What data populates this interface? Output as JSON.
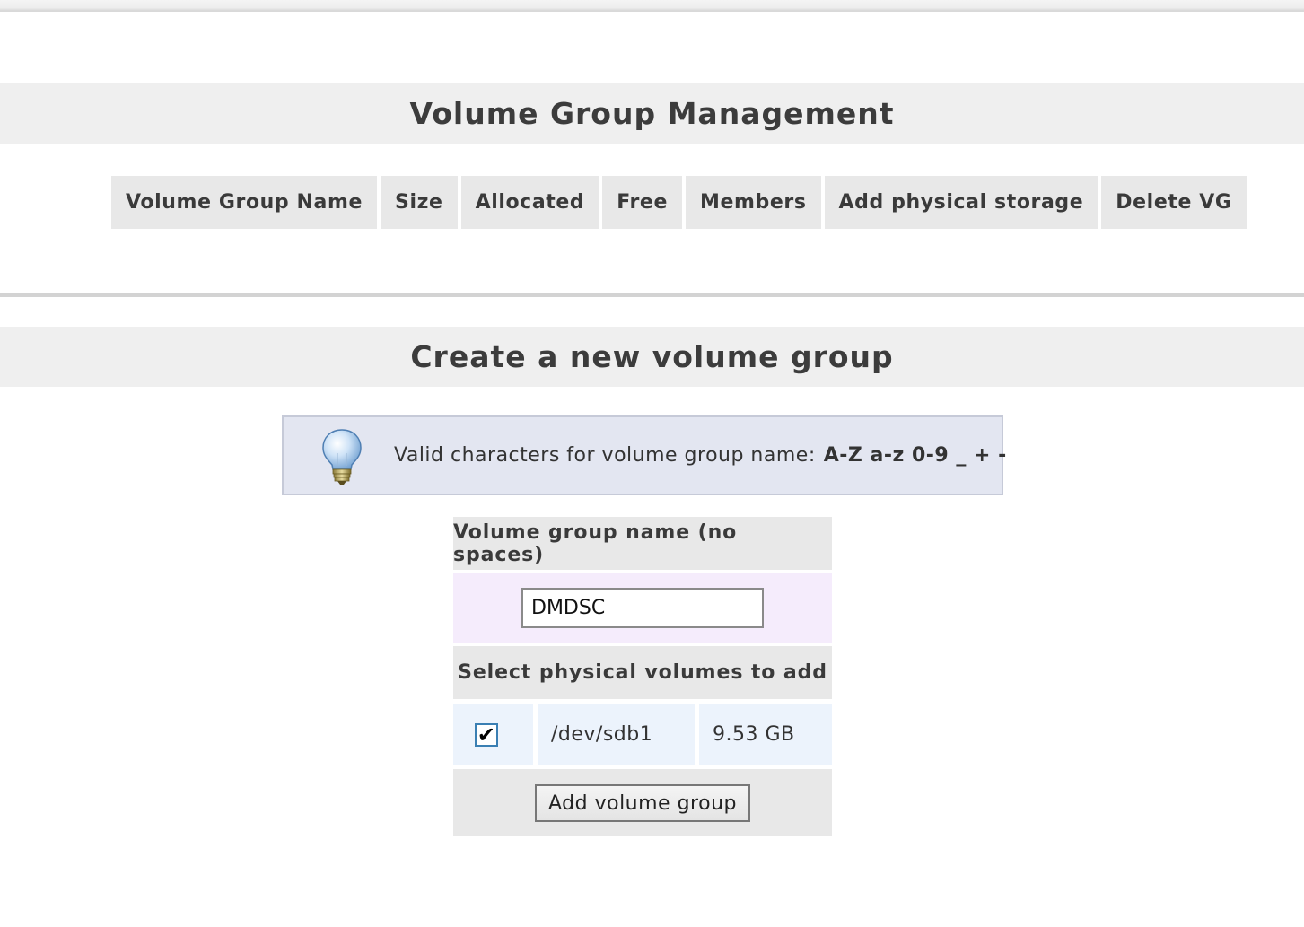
{
  "vg_section": {
    "title": "Volume Group Management",
    "columns": [
      "Volume Group Name",
      "Size",
      "Allocated",
      "Free",
      "Members",
      "Add physical storage",
      "Delete VG"
    ]
  },
  "create_section": {
    "title": "Create a new volume group",
    "tip": {
      "icon": "lightbulb-icon",
      "text": "Valid characters for volume group name:",
      "chars": "A-Z a-z 0-9 _ + -"
    },
    "name_label": "Volume group name (no spaces)",
    "name_value": "DMDSC",
    "pv_label": "Select physical volumes to add",
    "physical_volumes": [
      {
        "checked": true,
        "device": "/dev/sdb1",
        "size": "9.53 GB"
      }
    ],
    "submit_label": "Add volume group"
  },
  "colors": {
    "section_bar": "#efefef",
    "header_cell": "#e8e8e8",
    "tip_bg": "#e3e6f1",
    "input_row_bg": "#f5ecfc",
    "pv_row_bg": "#ecf3fc"
  }
}
